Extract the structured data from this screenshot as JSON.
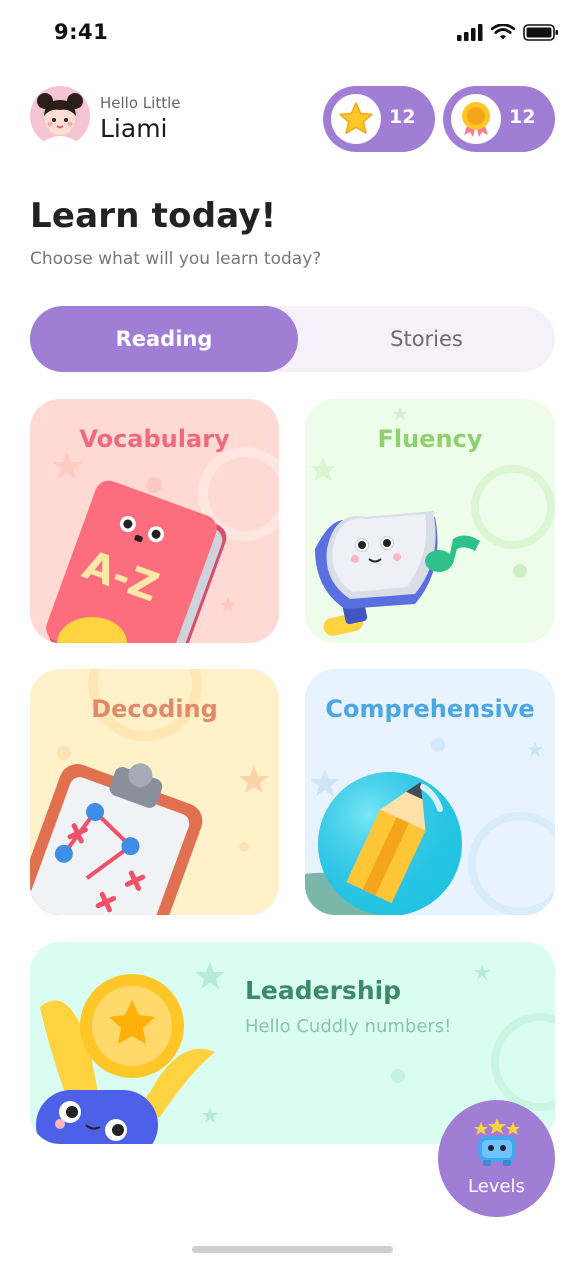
{
  "status_bar": {
    "time": "9:41"
  },
  "header": {
    "greeting": "Hello Little",
    "user_name": "Liami",
    "stars_count": "12",
    "medals_count": "12"
  },
  "page": {
    "title": "Learn today!",
    "subtitle": "Choose what will you learn today?"
  },
  "tabs": [
    {
      "label": "Reading",
      "active": true
    },
    {
      "label": "Stories",
      "active": false
    }
  ],
  "cards": {
    "vocabulary": {
      "label": "Vocabulary",
      "color": "#f06a7e"
    },
    "fluency": {
      "label": "Fluency",
      "color": "#8fd16f"
    },
    "decoding": {
      "label": "Decoding",
      "color": "#e08a6a"
    },
    "comprehensive": {
      "label": "Comprehensive",
      "color": "#4ca6e3"
    },
    "leadership": {
      "title": "Leadership",
      "subtitle": "Hello Cuddly numbers!"
    }
  },
  "levels_button": {
    "label": "Levels"
  },
  "colors": {
    "accent": "#a07ed6",
    "tab_bg": "#f4f1fb"
  },
  "icons": [
    "signal-icon",
    "wifi-icon",
    "battery-icon",
    "star-icon",
    "medal-icon",
    "trophy-icon",
    "levels-icon"
  ]
}
